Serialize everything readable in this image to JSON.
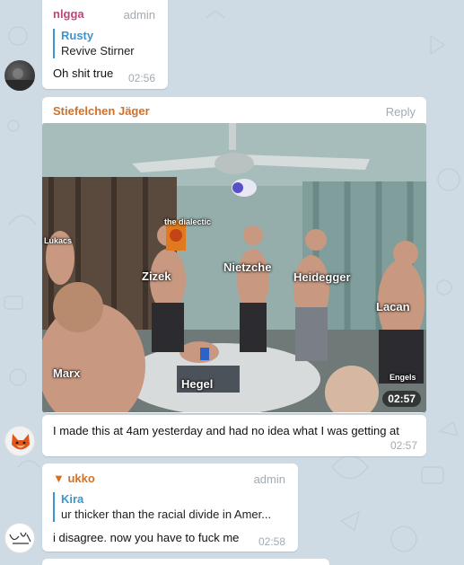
{
  "messages": [
    {
      "sender": "nlgga",
      "role": "admin",
      "reply": {
        "name": "Rusty",
        "text": "Revive Stirner"
      },
      "text": "Oh shit true",
      "time": "02:56"
    },
    {
      "sender": "Stiefelchen Jäger",
      "action": "Reply",
      "photo": {
        "labels": {
          "dialectic": "the dialectic",
          "lukacs": "Lukacs",
          "zizek": "Zizek",
          "nietzche": "Nietzche",
          "heidegger": "Heidegger",
          "lacan": "Lacan",
          "marx": "Marx",
          "hegel": "Hegel",
          "engels": "Engels"
        },
        "duration": "02:57"
      },
      "text": "I made this at 4am yesterday and had no idea what I was getting at",
      "time": "02:57"
    },
    {
      "sender": "▼ ukko",
      "role": "admin",
      "reply": {
        "name": "Kira",
        "text": "ur thicker than the racial divide in Amer..."
      },
      "text": "i disagree. now you have to fuck me",
      "time": "02:58"
    }
  ],
  "colors": {
    "sender1": "#c0437a",
    "sender2": "#d0712a",
    "sender3": "#d0712a",
    "reply_accent": "#3a95d1"
  },
  "icons": {
    "avatar1": "dark-photo-avatar",
    "avatar2": "orange-fox-avatar",
    "avatar3": "sketch-avatar"
  }
}
